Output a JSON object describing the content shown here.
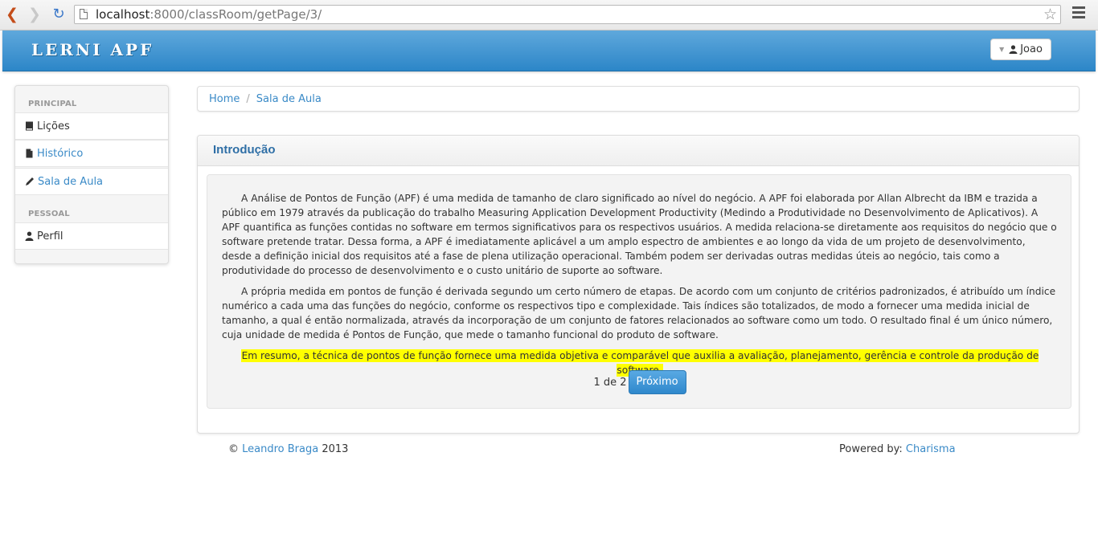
{
  "browser": {
    "url_host": "localhost",
    "url_path": ":8000/classRoom/getPage/3/"
  },
  "navbar": {
    "brand": "LERNI APF",
    "user": "Joao"
  },
  "sidebar": {
    "sections": [
      {
        "header": "PRINCIPAL"
      },
      {
        "header": "PESSOAL"
      }
    ],
    "items": [
      {
        "label": "Lições",
        "icon": "book-icon"
      },
      {
        "label": "Histórico",
        "icon": "file-icon"
      },
      {
        "label": "Sala de Aula",
        "icon": "pencil-icon"
      },
      {
        "label": "Perfil",
        "icon": "user-icon"
      }
    ]
  },
  "breadcrumb": {
    "items": [
      "Home",
      "Sala de Aula"
    ],
    "separator": "/"
  },
  "panel": {
    "title": "Introdução",
    "paragraphs": [
      "A Análise de Pontos de Função (APF) é uma medida de tamanho de claro significado ao nível do negócio. A APF foi elaborada por Allan Albrecht da IBM e trazida a público em 1979 através da publicação do trabalho Measuring Application Development Productivity (Medindo a Produtividade no Desenvolvimento de Aplicativos). A APF quantifica as funções contidas no software em termos significativos para os respectivos usuários. A medida relaciona-se diretamente aos requisitos do negócio que o software pretende tratar. Dessa forma, a APF é imediatamente aplicável a um amplo espectro de ambientes e ao longo da vida de um projeto de desenvolvimento, desde a definição inicial dos requisitos até a fase de plena utilização operacional. Também podem ser derivadas outras medidas úteis ao negócio, tais como a produtividade do processo de desenvolvimento e o custo unitário de suporte ao software.",
      "A própria medida em pontos de função é derivada segundo um certo número de etapas. De acordo com um conjunto de critérios padronizados, é atribuído um índice numérico a cada uma das funções do negócio, conforme os respectivos tipo e complexidade. Tais índices são totalizados, de modo a fornecer uma medida inicial de tamanho, a qual é então normalizada, através da incorporação de um conjunto de fatores relacionados ao software como um todo. O resultado final é um único número, cuja unidade de medida é Pontos de Função, que mede o tamanho funcional do produto de software."
    ],
    "summary": "Em resumo, a técnica de pontos de função fornece uma medida objetiva e comparável que auxilia a avaliação, planejamento, gerência e controle da produção de software.",
    "pager_text": "1 de 2",
    "next_label": "Próximo"
  },
  "footer": {
    "copyright_symbol": "©",
    "author": "Leandro Braga",
    "year": "2013",
    "powered_label": "Powered by:",
    "powered_link": "Charisma"
  },
  "colors": {
    "accent": "#2c86c8",
    "link": "#3a8ac7",
    "highlight": "#ffff00"
  }
}
